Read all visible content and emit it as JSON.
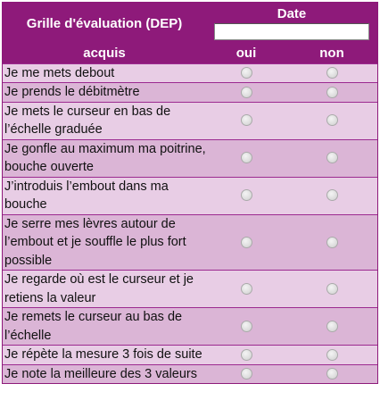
{
  "header": {
    "title": "Grille d'évaluation (DEP)",
    "date_label": "Date",
    "date_value": "",
    "col_acquis": "acquis",
    "col_oui": "oui",
    "col_non": "non"
  },
  "colors": {
    "header": "#8e1a7a",
    "row_light": "#e8cde5",
    "row_dark": "#dbb5d6"
  },
  "rows": [
    "Je me mets debout",
    "Je prends le débitmètre",
    "Je mets le curseur en bas de l’échelle graduée",
    "Je gonfle au maximum ma poitrine, bouche ouverte",
    "J’introduis l’embout dans ma bouche",
    "Je serre mes lèvres autour de l’embout et je souffle le plus fort possible",
    "Je regarde où est le curseur et je retiens la valeur",
    "Je remets le curseur au bas de l’échelle",
    "Je répète la mesure 3 fois de suite",
    "Je note la meilleure des 3 valeurs"
  ]
}
